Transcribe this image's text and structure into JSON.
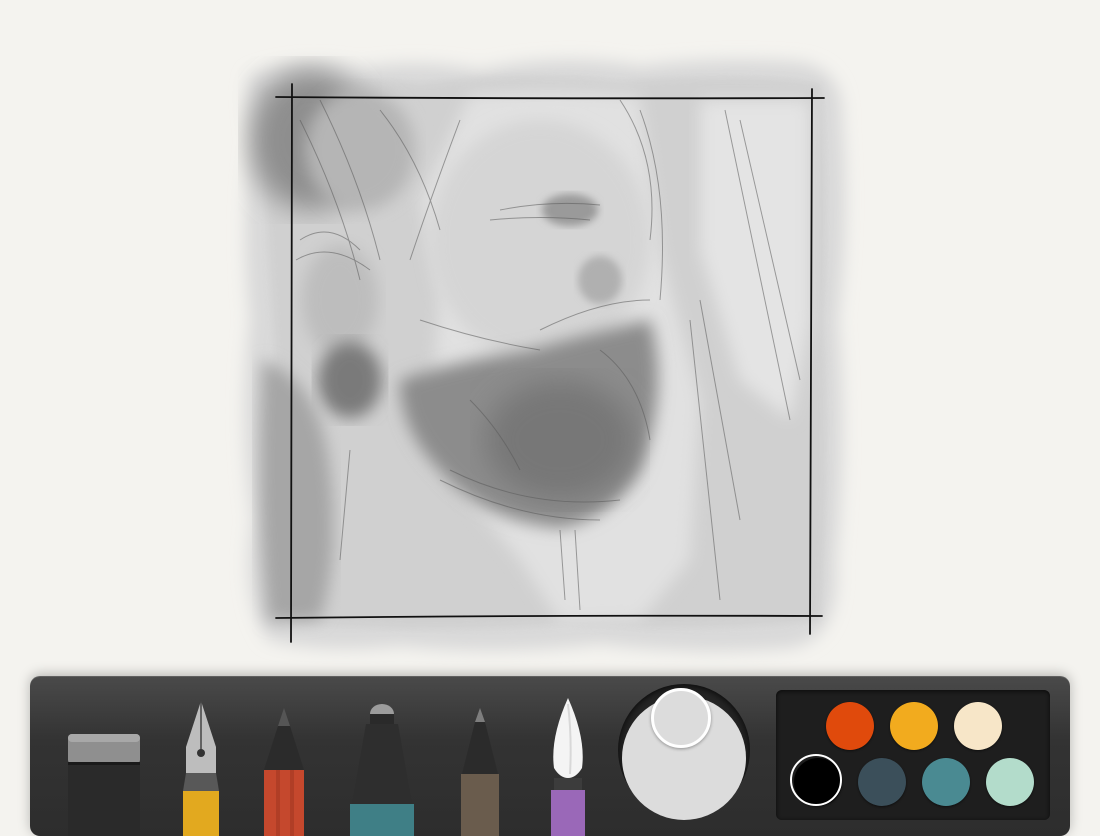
{
  "app": {
    "canvas_background": "#f4f3ef"
  },
  "drawing": {
    "subject": "pencil-and-watercolor-sketch-bearded-face"
  },
  "toolbar": {
    "tools": [
      {
        "name": "eraser",
        "icon": "eraser-icon",
        "accent": "#2a2a2a"
      },
      {
        "name": "fountain-pen",
        "icon": "fountain-pen-icon",
        "accent": "#e2a91f"
      },
      {
        "name": "pencil",
        "icon": "pencil-icon",
        "accent": "#c5482d"
      },
      {
        "name": "marker",
        "icon": "marker-icon",
        "accent": "#3f7f86"
      },
      {
        "name": "fineliner",
        "icon": "fineliner-icon",
        "accent": "#6a5c4d"
      },
      {
        "name": "watercolor-brush",
        "icon": "watercolor-brush-icon",
        "accent": "#9a68b8"
      }
    ],
    "current_color": "#dcdcdc",
    "palette": [
      {
        "color": "#e04a0c",
        "selected": false
      },
      {
        "color": "#f2ab1e",
        "selected": false
      },
      {
        "color": "#f7e6c8",
        "selected": false
      },
      {
        "color": "#000000",
        "selected": true
      },
      {
        "color": "#3b4f5a",
        "selected": false
      },
      {
        "color": "#4a8a92",
        "selected": false
      },
      {
        "color": "#b3dccb",
        "selected": false
      }
    ]
  }
}
